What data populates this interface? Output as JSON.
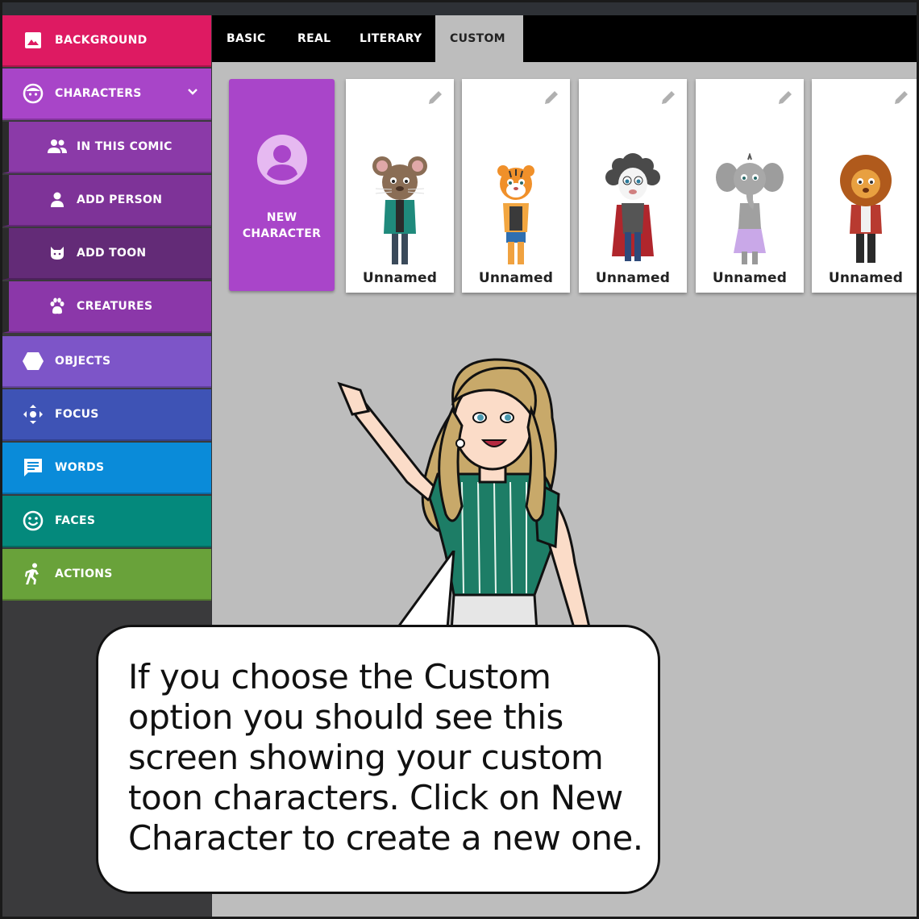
{
  "sidebar": {
    "items": [
      {
        "label": "BACKGROUND",
        "icon": "image-icon",
        "color": "#de1a62"
      },
      {
        "label": "CHARACTERS",
        "icon": "face-icon",
        "color": "#a845c8"
      },
      {
        "label": "IN THIS COMIC",
        "icon": "people-icon",
        "color": "#8b3aa8"
      },
      {
        "label": "ADD PERSON",
        "icon": "person-icon",
        "color": "#7e3398"
      },
      {
        "label": "ADD TOON",
        "icon": "cat-icon",
        "color": "#632b77"
      },
      {
        "label": "CREATURES",
        "icon": "paw-icon",
        "color": "#8b37a9"
      },
      {
        "label": "OBJECTS",
        "icon": "hexagon-icon",
        "color": "#7d55c8"
      },
      {
        "label": "FOCUS",
        "icon": "move-icon",
        "color": "#3e53b5"
      },
      {
        "label": "WORDS",
        "icon": "chat-icon",
        "color": "#0a8bd9"
      },
      {
        "label": "FACES",
        "icon": "smile-icon",
        "color": "#04897c"
      },
      {
        "label": "ACTIONS",
        "icon": "run-icon",
        "color": "#69a23a"
      }
    ]
  },
  "tabs": [
    {
      "label": "BASIC"
    },
    {
      "label": "REAL"
    },
    {
      "label": "LITERARY"
    },
    {
      "label": "CUSTOM"
    }
  ],
  "new_character": {
    "label": "NEW CHARACTER"
  },
  "cards": [
    {
      "name": "Unnamed"
    },
    {
      "name": "Unnamed"
    },
    {
      "name": "Unnamed"
    },
    {
      "name": "Unnamed"
    },
    {
      "name": "Unnamed"
    }
  ],
  "bubble": {
    "text": "If you choose the Custom option you should see this screen showing your custom toon characters. Click on New Character to create a new one."
  }
}
